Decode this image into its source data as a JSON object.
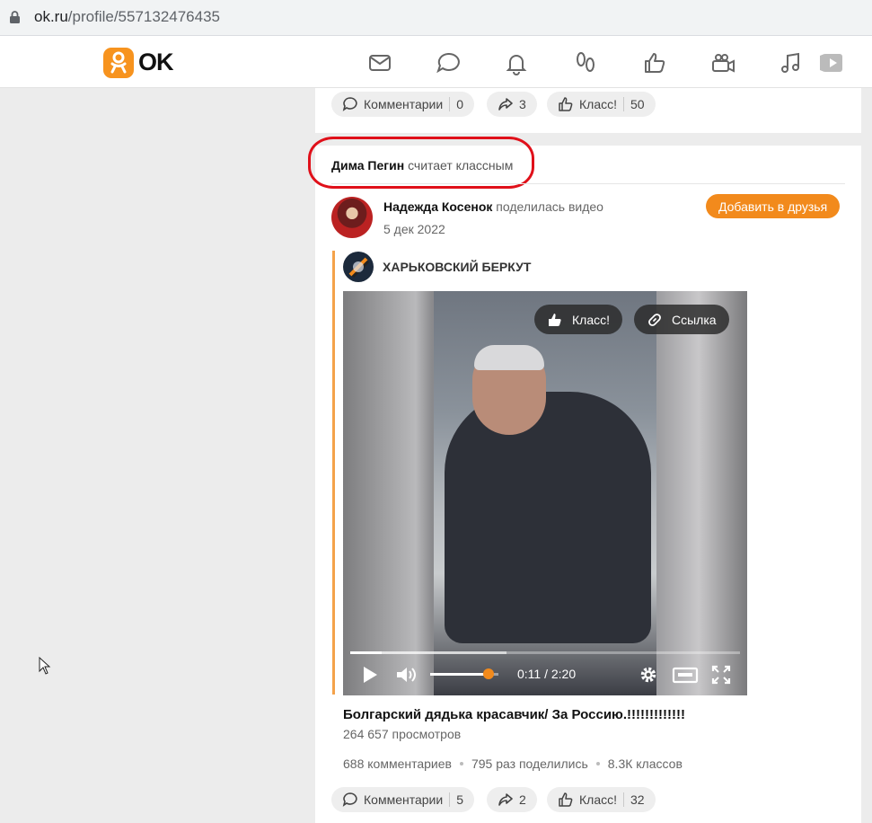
{
  "browser": {
    "url_domain": "ok.ru",
    "url_path": "/profile/557132476435"
  },
  "header": {
    "logo_text": "OK",
    "brand_color": "#f7931e",
    "nav_icons": [
      "mail-icon",
      "chat-icon",
      "bell-icon",
      "guests-icon",
      "likes-icon",
      "video-camera-icon",
      "music-icon",
      "video-play-icon"
    ]
  },
  "top_post_actions": {
    "comments_label": "Комментарии",
    "comments_count": "0",
    "shares_count": "3",
    "likes_label": "Класс!",
    "likes_count": "50"
  },
  "post": {
    "liker_name": "Дима Пегин",
    "liker_action": "считает классным",
    "author_name": "Надежда Косенок",
    "author_action": "поделилась видео",
    "date": "5 дек 2022",
    "add_friend_label": "Добавить в друзья",
    "group_name": "ХАРЬКОВСКИЙ БЕРКУТ",
    "video": {
      "like_label": "Класс!",
      "link_label": "Ссылка",
      "time": "0:11 / 2:20",
      "progress_fraction": 0.08,
      "buffered_fraction": 0.4,
      "volume_fraction": 0.85
    },
    "video_title": "Болгарский дядька красавчик/ За Россию.!!!!!!!!!!!!!",
    "views": "264 657 просмотров",
    "stats": {
      "comments": "688 комментариев",
      "shares": "795 раз поделились",
      "likes": "8.3К классов"
    },
    "actions": {
      "comments_label": "Комментарии",
      "comments_count": "5",
      "shares_count": "2",
      "likes_label": "Класс!",
      "likes_count": "32"
    }
  },
  "accent_color": "#f28a1c",
  "highlight_color": "#e0101a"
}
